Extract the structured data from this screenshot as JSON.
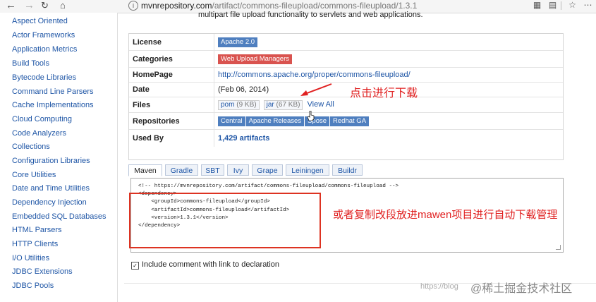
{
  "browser": {
    "back_icon": "back-arrow-icon",
    "forward_icon": "forward-arrow-icon",
    "url_host": "mvnrepository.com",
    "url_path": "/artifact/commons-fileupload/commons-fileupload/1.3.1"
  },
  "sidebar": {
    "items": [
      "Aspect Oriented",
      "Actor Frameworks",
      "Application Metrics",
      "Build Tools",
      "Bytecode Libraries",
      "Command Line Parsers",
      "Cache Implementations",
      "Cloud Computing",
      "Code Analyzers",
      "Collections",
      "Configuration Libraries",
      "Core Utilities",
      "Date and Time Utilities",
      "Dependency Injection",
      "Embedded SQL Databases",
      "HTML Parsers",
      "HTTP Clients",
      "I/O Utilities",
      "JDBC Extensions",
      "JDBC Pools"
    ]
  },
  "main": {
    "description": "multipart file upload functionality to servlets and web applications.",
    "info": {
      "license_label": "License",
      "license_value": "Apache 2.0",
      "categories_label": "Categories",
      "categories_value": "Web Upload Managers",
      "homepage_label": "HomePage",
      "homepage_value": "http://commons.apache.org/proper/commons-fileupload/",
      "date_label": "Date",
      "date_value": "(Feb 06, 2014)",
      "files_label": "Files",
      "files_pom": "pom",
      "files_pom_size": "(9 KB)",
      "files_jar": "jar",
      "files_jar_size": "(67 KB)",
      "files_viewall": "View All",
      "repositories_label": "Repositories",
      "repositories": [
        "Central",
        "Apache Releases",
        "Spose",
        "Redhat GA"
      ],
      "usedby_label": "Used By",
      "usedby_value": "1,429 artifacts"
    },
    "tabs": [
      "Maven",
      "Gradle",
      "SBT",
      "Ivy",
      "Grape",
      "Leiningen",
      "Buildr"
    ],
    "code": "<!-- https://mvnrepository.com/artifact/commons-fileupload/commons-fileupload -->\n<dependency>\n    <groupId>commons-fileupload</groupId>\n    <artifactId>commons-fileupload</artifactId>\n    <version>1.3.1</version>\n</dependency>",
    "include_comment_label": "Include comment with link to declaration"
  },
  "annotations": {
    "click_download": "点击进行下载",
    "copy_hint": "或者复制改段放进mawen项目进行自动下载管理"
  },
  "watermark": {
    "text": "@稀土掘金技术社区",
    "faint": "https://blog"
  },
  "colors": {
    "link": "#1f56a6",
    "badge_blue": "#4f7fbf",
    "badge_red": "#d9534f",
    "annotation_red": "#e02020"
  }
}
